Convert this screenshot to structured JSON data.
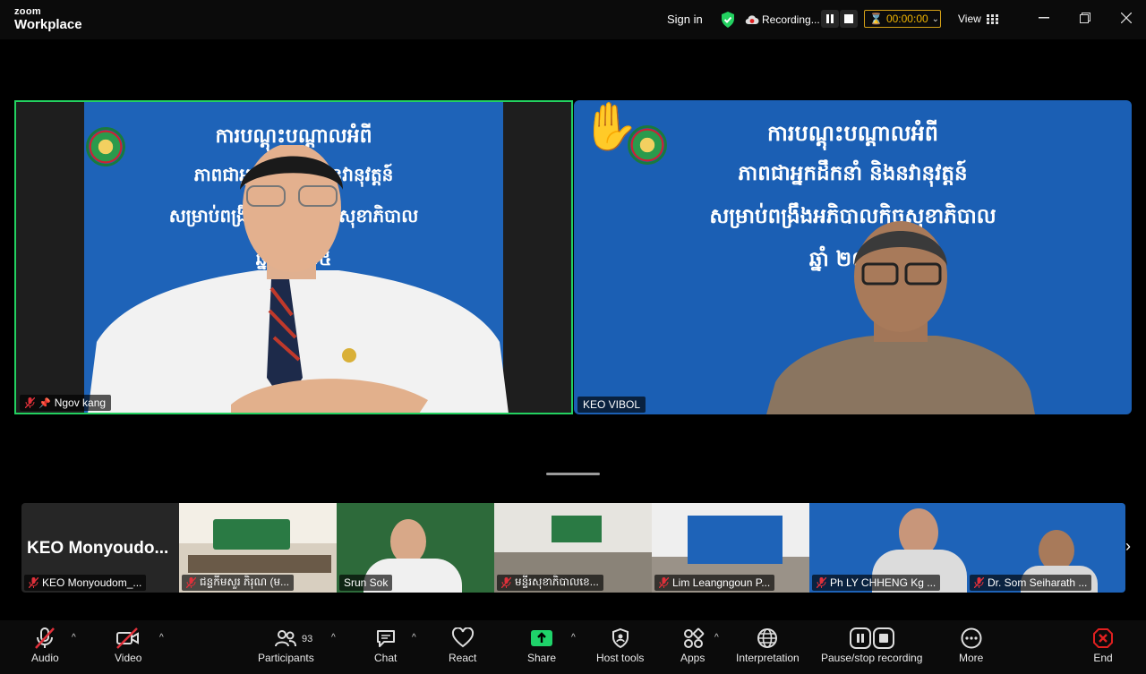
{
  "app": {
    "logo_line1": "zoom",
    "logo_line2": "Workplace"
  },
  "topbar": {
    "sign_in": "Sign in",
    "recording": "Recording...",
    "timer": "00:00:00",
    "view": "View",
    "colors": {
      "secure": "#23d160",
      "timer": "#f0b400"
    }
  },
  "slide": {
    "line1": "ការបណ្តុះបណ្តាលអំពី",
    "line2": "ភាពជាអ្នកដឹកនាំ និងនវានុវត្តន៍",
    "line3": "សម្រាប់ពង្រឹងអភិបាលកិច្ចសុខាភិបាល",
    "line4": "ឆ្នាំ ២០២៥"
  },
  "main_tiles": {
    "left_name": "Ngov kang",
    "right_name": "KEO VIBOL"
  },
  "strip": [
    {
      "name": "KEO Monyoudom_...",
      "big": "KEO  Monyoudo..."
    },
    {
      "name": "ជន្ទកីមសួរ ភិរុណ (ម..."
    },
    {
      "name": "Srun Sok"
    },
    {
      "name": "មន្ទីរសុខាភិបាលខេ..."
    },
    {
      "name": "Lim Leangngoun P..."
    },
    {
      "name": "Ph LY CHHENG Kg ..."
    },
    {
      "name": "Dr. Som Seiharath ..."
    }
  ],
  "toolbar": {
    "audio": "Audio",
    "video": "Video",
    "participants": "Participants",
    "participants_count": "93",
    "chat": "Chat",
    "react": "React",
    "share": "Share",
    "host_tools": "Host tools",
    "apps": "Apps",
    "interpretation": "Interpretation",
    "pause_recording": "Pause/stop recording",
    "more": "More",
    "end": "End",
    "colors": {
      "share": "#1fd36a",
      "end": "#e02020",
      "muted": "#e0303a"
    }
  }
}
